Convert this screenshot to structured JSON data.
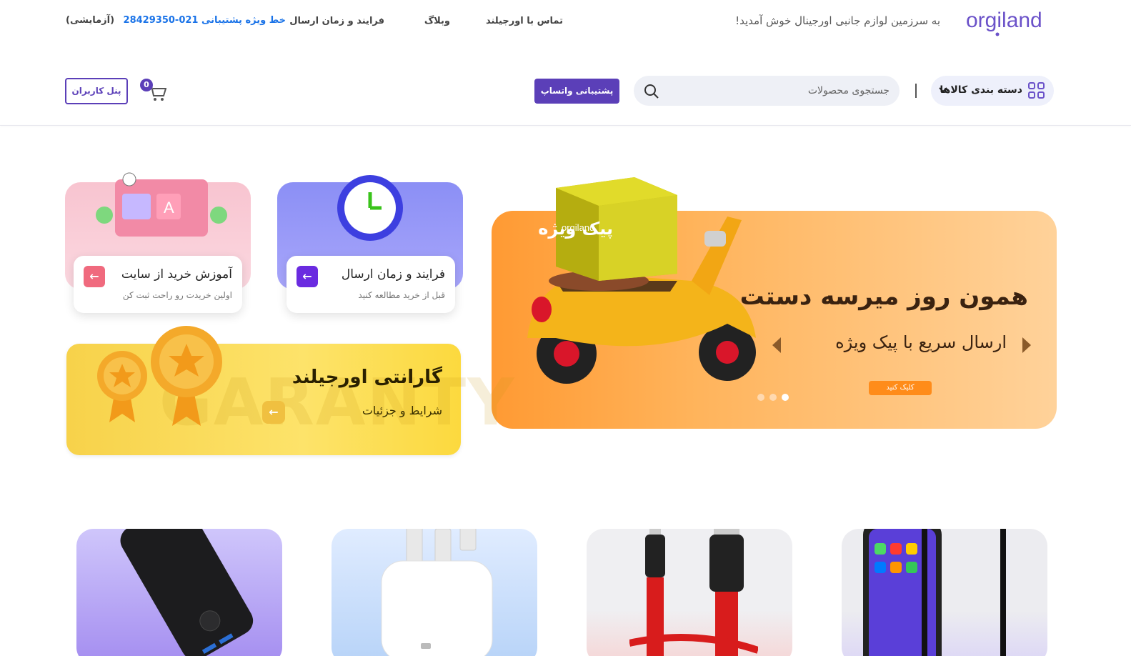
{
  "brand": {
    "logo_text": "orgiland"
  },
  "header": {
    "welcome": "به سرزمین لوازم جانبی اورجینال خوش آمدید!",
    "nav": [
      {
        "label": "تماس با اورجیلند"
      },
      {
        "label": "وبلاگ"
      },
      {
        "label": "فرایند و زمان ارسال"
      }
    ],
    "support_label": "خط ویژه پشتیبانی 021-28429350",
    "support_note": "(آزمایشی)",
    "categories_label": "دسته بندی کالاها",
    "search_placeholder": "جستجوی محصولات",
    "whatsapp_label": "پشتیبانی واتساپ",
    "cart_count": "0",
    "user_panel_label": "پنل کاربران"
  },
  "hero": {
    "title": "همون روز میرسه دستت",
    "subtitle": "ارسال سریع با پیک ویژه",
    "cta": "کلیک کنید",
    "box_label": "پیک ویژه",
    "box_brand": "orgiland",
    "slides": 3,
    "active_slide": 1
  },
  "promos": [
    {
      "title": "فرایند و زمان ارسال",
      "subtitle": "قبل از خرید مطالعه کنید",
      "accent": "#6a2be0"
    },
    {
      "title": "آموزش خرید از سایت",
      "subtitle": "اولین خریدت رو راحت ثبت کن",
      "accent": "#f06a7e"
    }
  ],
  "warranty": {
    "title": "گارانتی اورجیلند",
    "subtitle": "شرایط و جزئیات",
    "watermark": "GARANTY"
  },
  "tiles": [
    {
      "icon": "iphone-screen-protector-icon"
    },
    {
      "icon": "anker-cable-icon"
    },
    {
      "icon": "apple-charger-icon"
    },
    {
      "icon": "anker-powerbank-icon"
    }
  ],
  "colors": {
    "accent": "#5b3fb8",
    "support_blue": "#1a73e8",
    "hero_orange": "#ff9a33"
  }
}
